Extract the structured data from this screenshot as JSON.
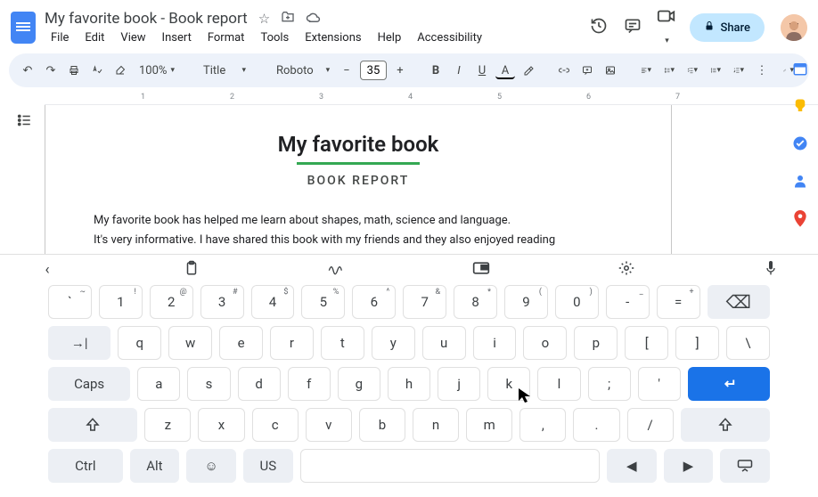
{
  "doc_title": "My favorite book - Book report",
  "menubar": [
    "File",
    "Edit",
    "View",
    "Insert",
    "Format",
    "Tools",
    "Extensions",
    "Help",
    "Accessibility"
  ],
  "share_label": "Share",
  "toolbar": {
    "zoom": "100%",
    "style": "Title",
    "font": "Roboto",
    "font_size": "35"
  },
  "ruler_marks": [
    "1",
    "2",
    "3",
    "4",
    "5",
    "6",
    "7"
  ],
  "document": {
    "heading": "My favorite book",
    "subheading": "BOOK REPORT",
    "para1": "My favorite book has helped me learn about shapes, math, science and language.",
    "para2": "It's very informative. I have shared this book with my friends and they also enjoyed reading"
  },
  "keyboard": {
    "row1": [
      {
        "main": "`",
        "sup": "~"
      },
      {
        "main": "1",
        "sup": "!"
      },
      {
        "main": "2",
        "sup": "@"
      },
      {
        "main": "3",
        "sup": "#"
      },
      {
        "main": "4",
        "sup": "$"
      },
      {
        "main": "5",
        "sup": "%"
      },
      {
        "main": "6",
        "sup": "^"
      },
      {
        "main": "7",
        "sup": "&"
      },
      {
        "main": "8",
        "sup": "*"
      },
      {
        "main": "9",
        "sup": "("
      },
      {
        "main": "0",
        "sup": ")"
      },
      {
        "main": "-",
        "sup": "_"
      },
      {
        "main": "=",
        "sup": "+"
      }
    ],
    "row2": [
      "q",
      "w",
      "e",
      "r",
      "t",
      "y",
      "u",
      "i",
      "o",
      "p",
      "[",
      "]",
      "\\"
    ],
    "caps": "Caps",
    "row3": [
      "a",
      "s",
      "d",
      "f",
      "g",
      "h",
      "j",
      "k",
      "l",
      ";",
      "'"
    ],
    "row4": [
      "z",
      "x",
      "c",
      "v",
      "b",
      "n",
      "m",
      ",",
      ".",
      "/"
    ],
    "ctrl": "Ctrl",
    "alt": "Alt",
    "lang": "US",
    "tab": "→|"
  }
}
